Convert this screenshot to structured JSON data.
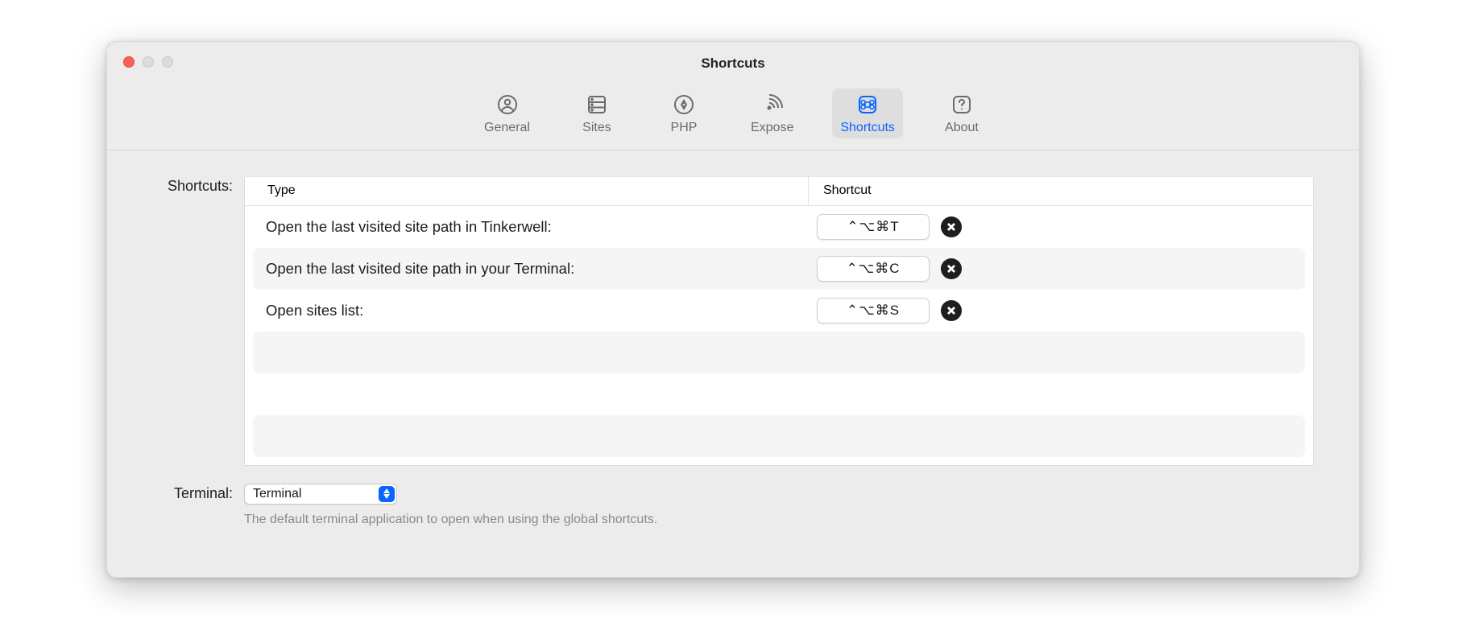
{
  "window": {
    "title": "Shortcuts"
  },
  "tabs": [
    {
      "label": "General"
    },
    {
      "label": "Sites"
    },
    {
      "label": "PHP"
    },
    {
      "label": "Expose"
    },
    {
      "label": "Shortcuts"
    },
    {
      "label": "About"
    }
  ],
  "sectionLabel": "Shortcuts:",
  "headers": {
    "type": "Type",
    "shortcut": "Shortcut"
  },
  "rows": [
    {
      "type": "Open the last visited site path in Tinkerwell:",
      "shortcut": "⌃⌥⌘T"
    },
    {
      "type": "Open the last visited site path in your Terminal:",
      "shortcut": "⌃⌥⌘C"
    },
    {
      "type": "Open sites list:",
      "shortcut": "⌃⌥⌘S"
    }
  ],
  "terminal": {
    "label": "Terminal:",
    "value": "Terminal",
    "hint": "The default terminal application to open when using the global shortcuts."
  }
}
